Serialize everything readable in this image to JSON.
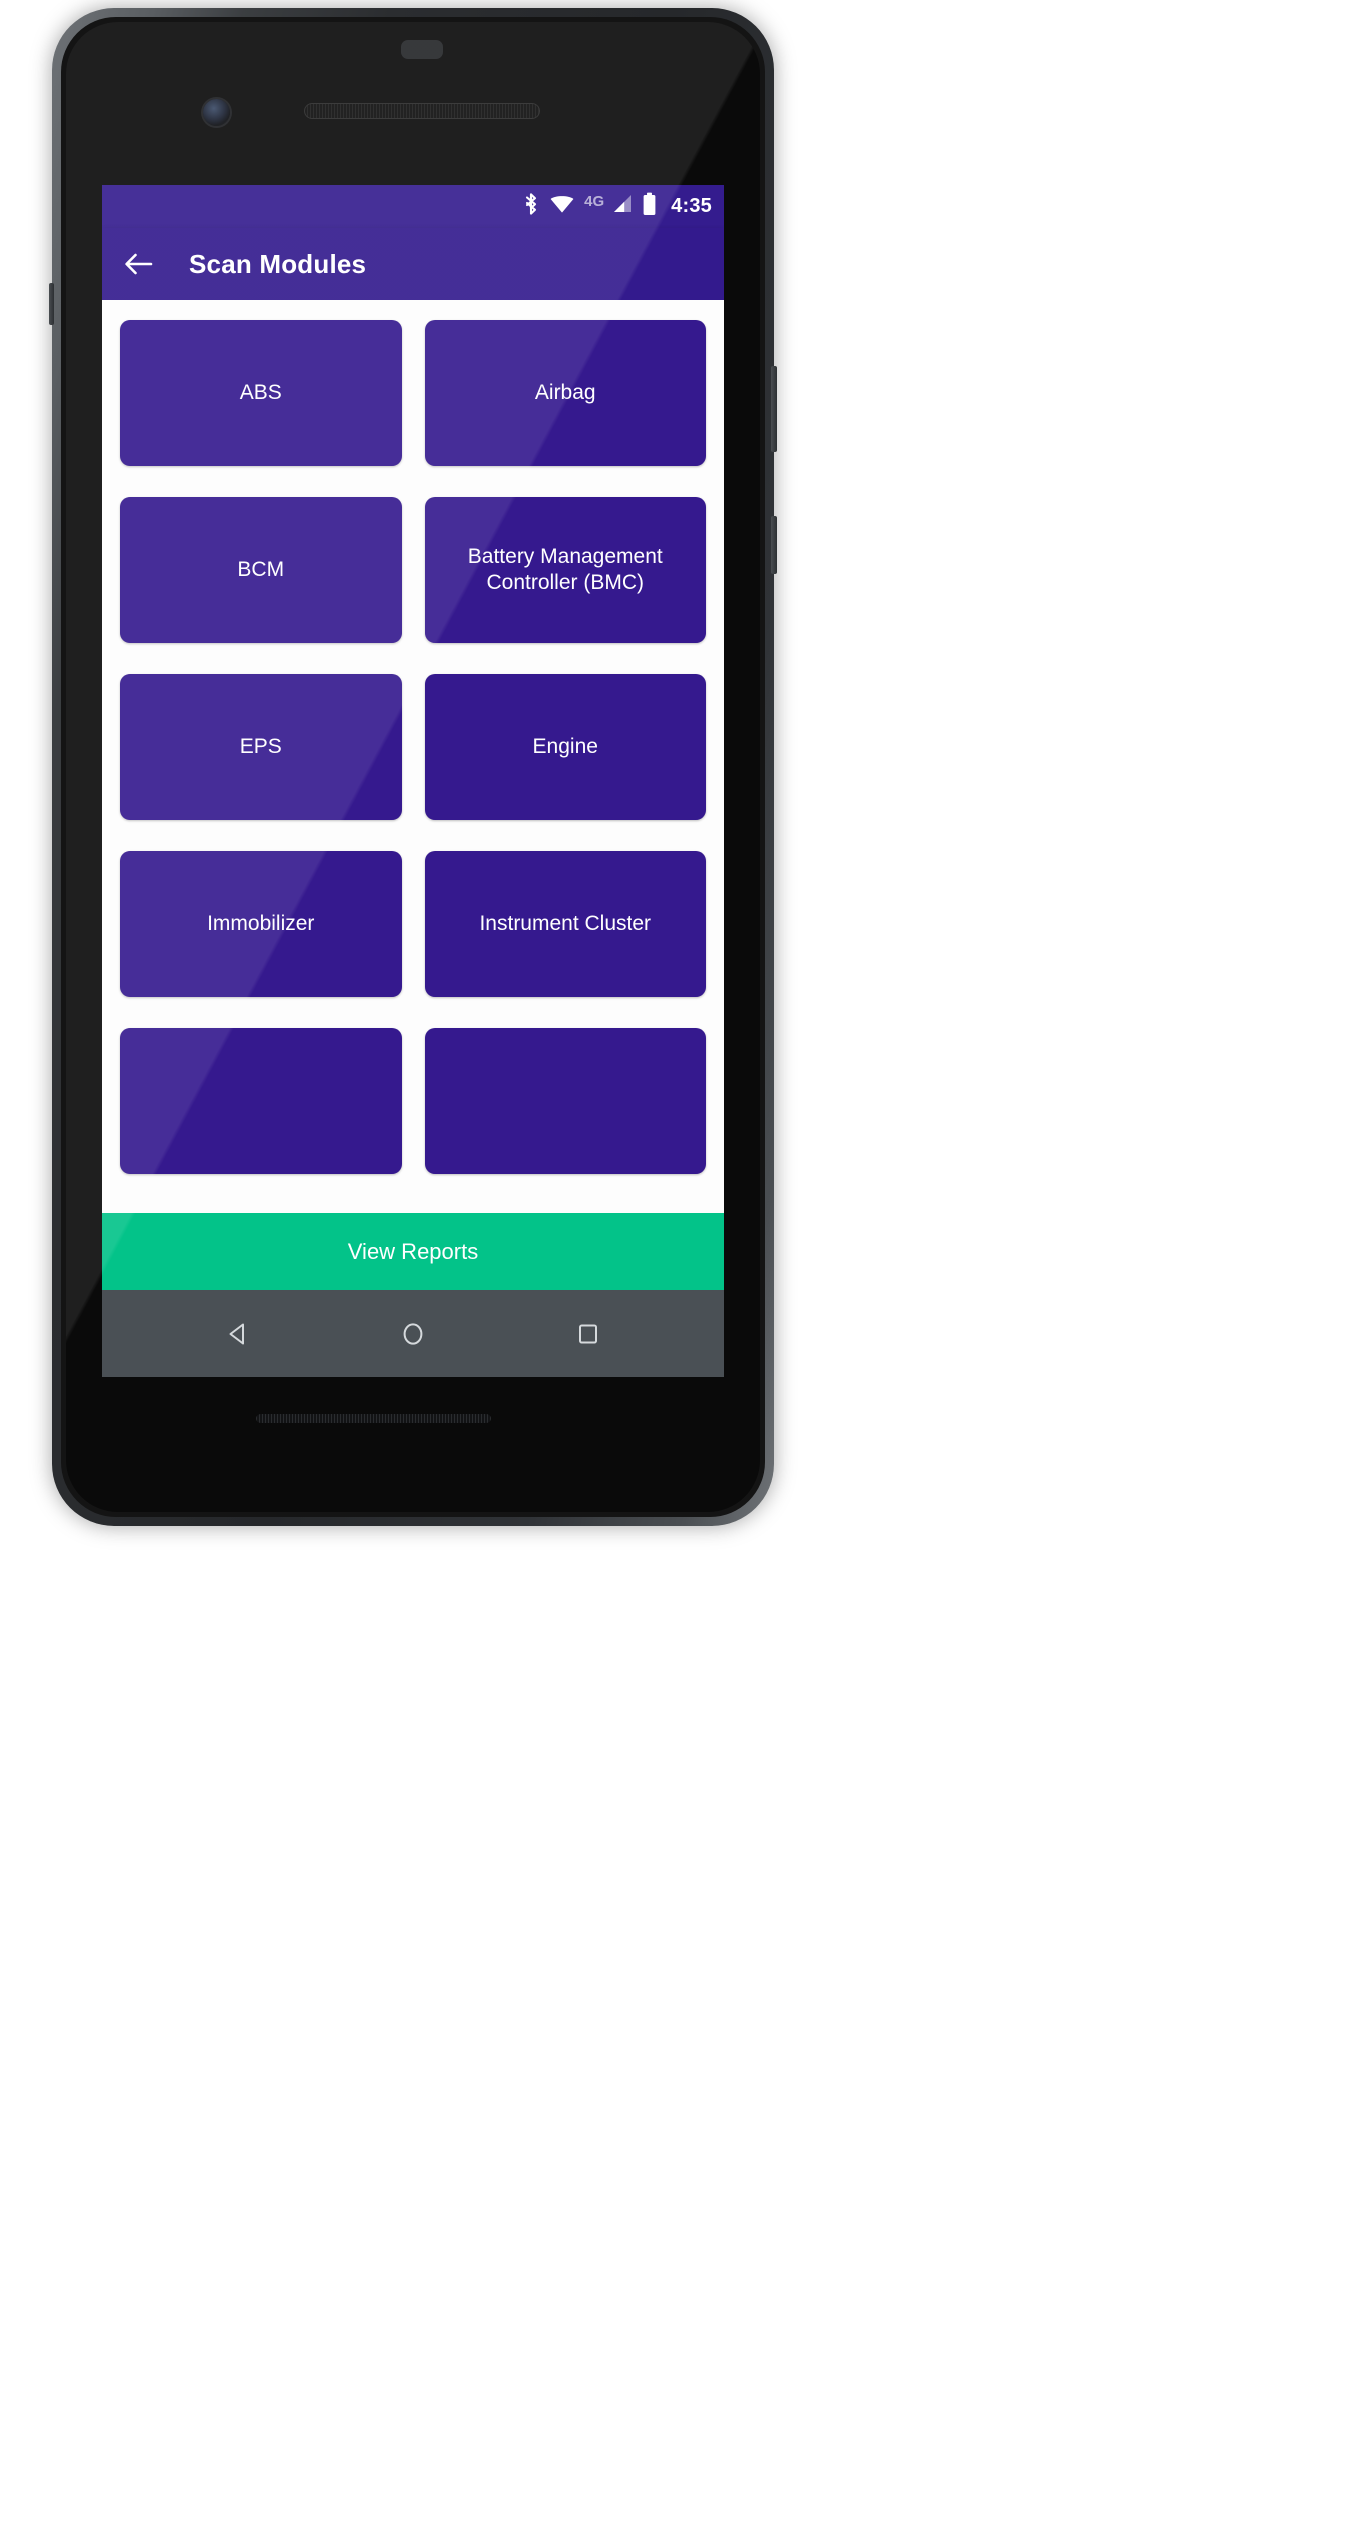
{
  "status_bar": {
    "network_label": "4G",
    "clock": "4:35",
    "icons": [
      "bluetooth-icon",
      "wifi-icon",
      "signal-icon",
      "battery-icon"
    ],
    "background_color": "#341C8E"
  },
  "app_bar": {
    "back_label": "back-arrow",
    "title": "Scan Modules",
    "background_color": "#331A8D"
  },
  "modules": [
    {
      "label": "ABS"
    },
    {
      "label": "Airbag"
    },
    {
      "label": "BCM"
    },
    {
      "label": "Battery Management\nController (BMC)"
    },
    {
      "label": "EPS"
    },
    {
      "label": "Engine"
    },
    {
      "label": "Immobilizer"
    },
    {
      "label": "Instrument Cluster"
    },
    {
      "label": ""
    },
    {
      "label": ""
    }
  ],
  "bottom_action": {
    "label": "View Reports",
    "background_color": "#03C389"
  },
  "nav_bar": {
    "back": "nav-back-icon",
    "home": "nav-home-icon",
    "recents": "nav-recents-icon",
    "background_color": "#4A5055"
  },
  "theme": {
    "module_button_color": "#35198E",
    "content_background": "#FDFDFD",
    "text_on_primary": "#FFFFFF"
  }
}
